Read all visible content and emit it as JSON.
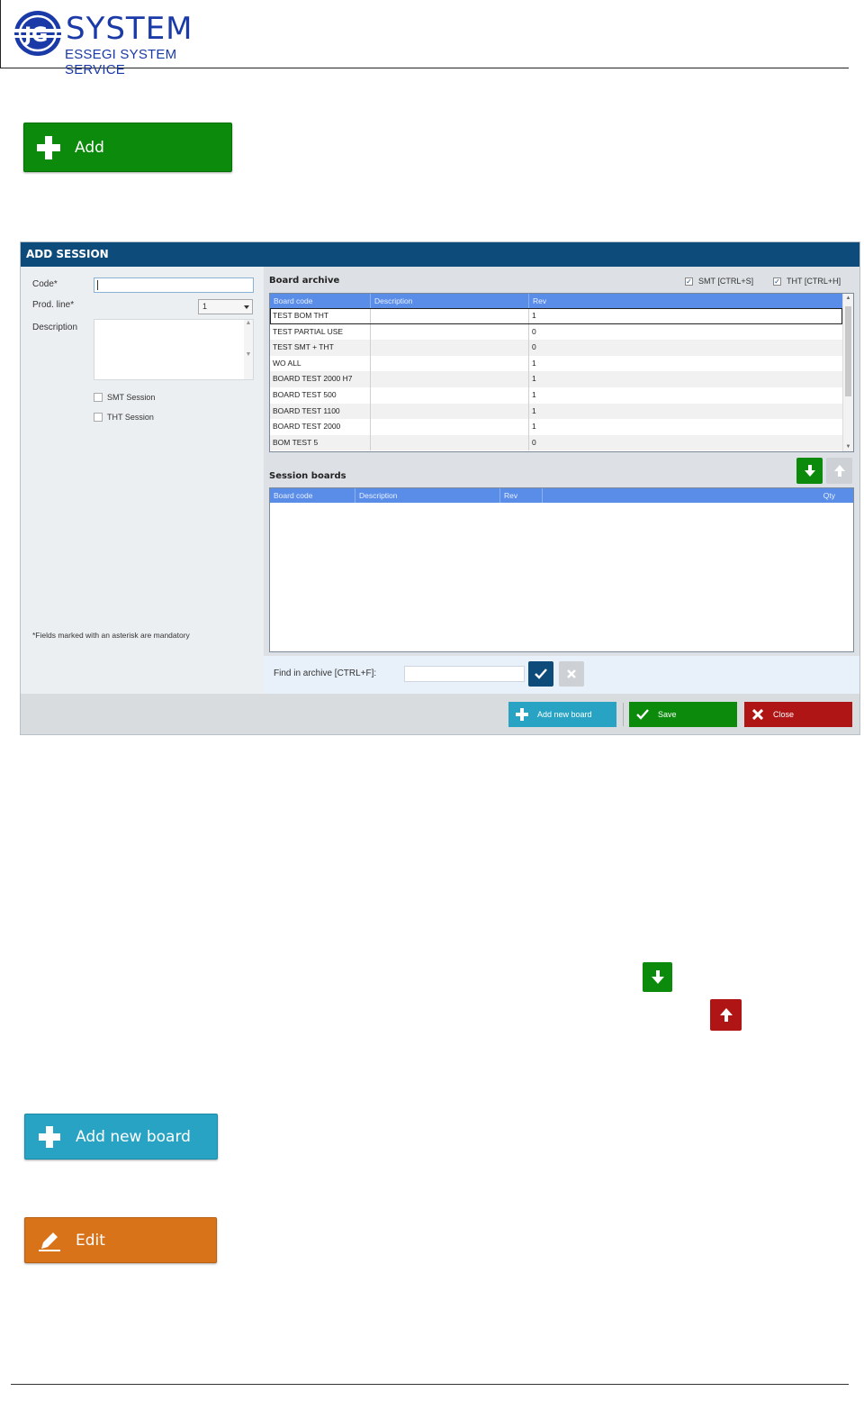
{
  "header": {
    "logo_main": "SYSTEM",
    "logo_sub": "ESSEGI SYSTEM SERVICE"
  },
  "buttons": {
    "add_label": "Add",
    "add_new_board_label": "Add new board",
    "edit_label": "Edit"
  },
  "dialog": {
    "title": "ADD SESSION",
    "form": {
      "code_label": "Code*",
      "code_value": "",
      "prod_line_label": "Prod. line*",
      "prod_line_value": "1",
      "description_label": "Description",
      "smt_session_label": "SMT Session",
      "tht_session_label": "THT Session",
      "mandatory_note": "*Fields marked with an asterisk are mandatory"
    },
    "board_archive": {
      "title": "Board archive",
      "smt_toggle": "SMT [CTRL+S]",
      "tht_toggle": "THT [CTRL+H]",
      "columns": [
        "Board code",
        "Description",
        "Rev"
      ],
      "rows": [
        {
          "code": "TEST BOM THT",
          "description": "",
          "rev": "1"
        },
        {
          "code": "TEST PARTIAL USE",
          "description": "",
          "rev": "0"
        },
        {
          "code": "TEST SMT + THT",
          "description": "",
          "rev": "0"
        },
        {
          "code": "WO ALL",
          "description": "",
          "rev": "1"
        },
        {
          "code": "BOARD TEST 2000 H7",
          "description": "",
          "rev": "1"
        },
        {
          "code": "BOARD TEST 500",
          "description": "",
          "rev": "1"
        },
        {
          "code": "BOARD TEST 1100",
          "description": "",
          "rev": "1"
        },
        {
          "code": "BOARD TEST 2000",
          "description": "",
          "rev": "1"
        },
        {
          "code": "BOM TEST 5",
          "description": "",
          "rev": "0"
        }
      ]
    },
    "session_boards": {
      "title": "Session boards",
      "columns": [
        "Board code",
        "Description",
        "Rev",
        "Qty"
      ]
    },
    "find": {
      "label": "Find in archive [CTRL+F]:",
      "value": ""
    },
    "footer": {
      "add_new_board": "Add new board",
      "save": "Save",
      "close": "Close"
    }
  },
  "colors": {
    "green": "#0b8a0b",
    "teal": "#29a3c4",
    "orange": "#d8731a",
    "red": "#b01515",
    "navy": "#0d4c7a",
    "grid_header": "#5a8de8"
  }
}
